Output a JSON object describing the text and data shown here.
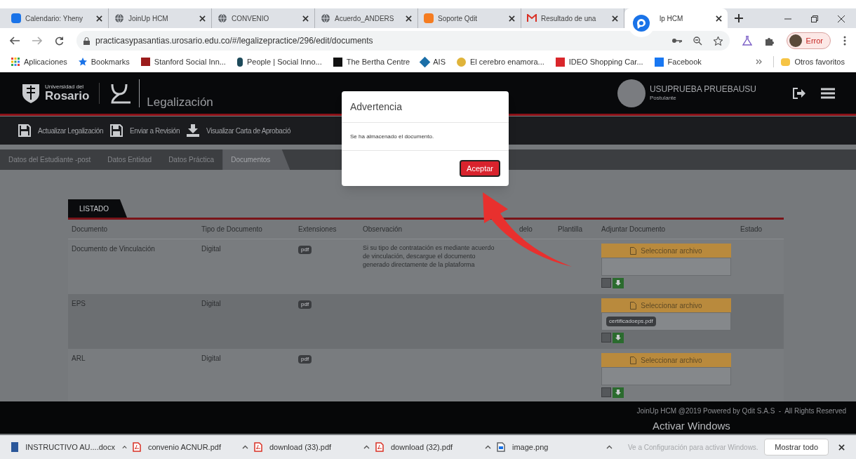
{
  "browser": {
    "tabs": [
      {
        "title": "Calendario: Yheny",
        "kind": "calendar",
        "selected": false
      },
      {
        "title": "JoinUp HCM",
        "kind": "globe",
        "selected": false
      },
      {
        "title": "CONVENIO",
        "kind": "globe",
        "selected": false
      },
      {
        "title": "Acuerdo_ANDERS",
        "kind": "globe",
        "selected": false
      },
      {
        "title": "Soporte Qdit",
        "kind": "orange",
        "selected": false
      },
      {
        "title": "Resultado de una",
        "kind": "mail",
        "selected": false
      },
      {
        "title": "lp HCM",
        "kind": "chat",
        "selected": true
      }
    ],
    "url": "practicasypasantias.urosario.edu.co/#/legalizepractice/296/edit/documents",
    "profile_label": "Error",
    "bookmarks": [
      {
        "label": "Aplicaciones",
        "kind": "apps"
      },
      {
        "label": "Bookmarks",
        "kind": "star"
      },
      {
        "label": "Stanford Social Inn...",
        "kind": "ssir"
      },
      {
        "label": "People | Social Inno...",
        "kind": "leaf"
      },
      {
        "label": "The Bertha Centre",
        "kind": "square"
      },
      {
        "label": "AIS",
        "kind": "hex"
      },
      {
        "label": "El cerebro enamora...",
        "kind": "circle"
      },
      {
        "label": "IDEO Shopping Car...",
        "kind": "ideo"
      },
      {
        "label": "Facebook",
        "kind": "facebook"
      }
    ],
    "other_bookmarks": "Otros favoritos"
  },
  "app": {
    "logo_small": "Universidad del",
    "logo_name": "Rosario",
    "title": "Legalización",
    "user": {
      "name": "USUPRUEBA PRUEBAUSU",
      "role": "Postulante"
    },
    "actions": [
      {
        "label": "Actualizar Legalización",
        "kind": "save"
      },
      {
        "label": "Enviar a Revisión",
        "kind": "save"
      },
      {
        "label": "Visualizar Carta de Aprobació",
        "kind": "download"
      }
    ],
    "tabs": [
      {
        "label": "Datos del Estudiante -post",
        "selected": false
      },
      {
        "label": "Datos Entidad",
        "selected": false
      },
      {
        "label": "Datos Práctica",
        "selected": false
      },
      {
        "label": "Documentos",
        "selected": true
      }
    ],
    "section_tab": "LISTADO",
    "columns": [
      "Documento",
      "Tipo de Documento",
      "Extensiones",
      "Observación",
      "delo",
      "Plantilla",
      "Adjuntar Documento",
      "Estado"
    ],
    "rows": [
      {
        "document": "Documento de Vinculación",
        "type": "Digital",
        "extension": "pdf",
        "note": "Si su tipo de contratación es mediante acuerdo de vinculación, descargue el documento generado directamente de la plataforma",
        "upload": "Seleccionar archivo"
      },
      {
        "document": "EPS",
        "type": "Digital",
        "extension": "pdf",
        "upload": "Seleccionar archivo",
        "file": "certificadoeps.pdf"
      },
      {
        "document": "ARL",
        "type": "Digital",
        "extension": "pdf",
        "upload": "Seleccionar archivo"
      }
    ],
    "footer": "JoinUp HCM @2019 Powered by Qdit S.A.S  -  All Rights Reserved"
  },
  "modal": {
    "title": "Advertencia",
    "message": "Se ha almacenado el documento.",
    "button": "Aceptar"
  },
  "windows_notice": {
    "title": "Activar Windows",
    "text": "Ve a Configuración para activar Windows."
  },
  "downloads": [
    {
      "name": "INSTRUCTIVO AU....docx",
      "kind": "doc"
    },
    {
      "name": "convenio ACNUR.pdf",
      "kind": "pdf"
    },
    {
      "name": "download (33).pdf",
      "kind": "pdf"
    },
    {
      "name": "download (32).pdf",
      "kind": "pdf"
    },
    {
      "name": "image.png",
      "kind": "image"
    }
  ],
  "show_all": "Mostrar todo"
}
